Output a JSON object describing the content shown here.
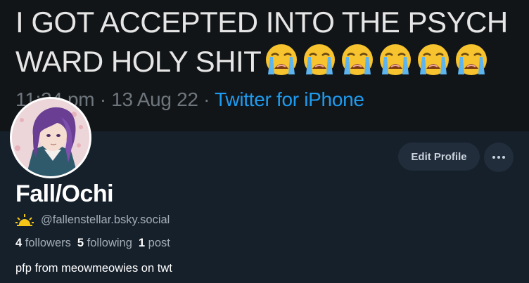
{
  "banner": {
    "tweet_text": "I GOT ACCEPTED INTO THE PSYCH WARD HOLY SHIT",
    "emoji_icons": [
      "loudly-crying-face",
      "loudly-crying-face",
      "loudly-crying-face",
      "loudly-crying-face",
      "loudly-crying-face",
      "loudly-crying-face"
    ],
    "timestamp": "11:24 pm · 13 Aug 22 · ",
    "source": "Twitter for iPhone"
  },
  "profile": {
    "display_name": "Fall/Ochi",
    "handle": "@fallenstellar.bsky.social",
    "followers_count": "4",
    "followers_label": "followers",
    "following_count": "5",
    "following_label": "following",
    "posts_count": "1",
    "posts_label": "post",
    "bio": "pfp from meowmeowies on twt"
  },
  "actions": {
    "edit_profile_label": "Edit Profile",
    "more_icon": "ellipsis-icon"
  },
  "colors": {
    "background": "#16202b",
    "banner_background": "#121518",
    "link": "#1d9bf0",
    "button_background": "#212d3b",
    "muted_text": "#a3adb8",
    "sun_icon": "#f5c518"
  }
}
